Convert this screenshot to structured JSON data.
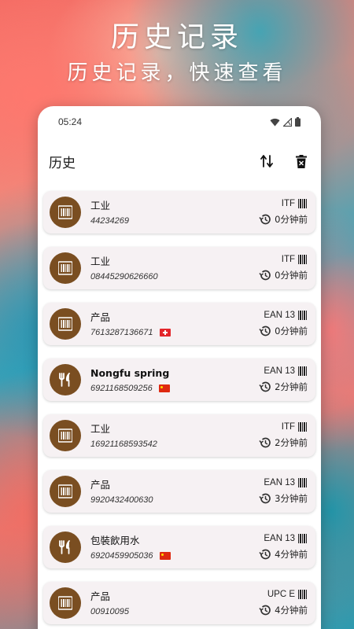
{
  "hero": {
    "title": "历史记录",
    "subtitle": "历史记录，快速查看"
  },
  "status_bar": {
    "time": "05:24",
    "icons": [
      "wifi-icon",
      "signal-icon",
      "battery-icon"
    ]
  },
  "app_bar": {
    "title": "历史",
    "actions": [
      "sort-icon",
      "delete-icon"
    ]
  },
  "colors": {
    "avatar_bg": "#7a4e21",
    "card_bg": "#f6f1f3",
    "text_primary": "#111111"
  },
  "history": [
    {
      "title": "工业",
      "code": "44234269",
      "type": "ITF",
      "time": "0分钟前",
      "icon": "barcode-icon",
      "flag": ""
    },
    {
      "title": "工业",
      "code": "08445290626660",
      "type": "ITF",
      "time": "0分钟前",
      "icon": "barcode-icon",
      "flag": ""
    },
    {
      "title": "产品",
      "code": "7613287136671",
      "type": "EAN 13",
      "time": "0分钟前",
      "icon": "barcode-icon",
      "flag": "switzerland-flag-icon"
    },
    {
      "title": "Nongfu spring",
      "code": "6921168509256",
      "type": "EAN 13",
      "time": "2分钟前",
      "icon": "fork-knife-icon",
      "flag": "china-flag-icon"
    },
    {
      "title": "工业",
      "code": "16921168593542",
      "type": "ITF",
      "time": "2分钟前",
      "icon": "barcode-icon",
      "flag": ""
    },
    {
      "title": "产品",
      "code": "9920432400630",
      "type": "EAN 13",
      "time": "3分钟前",
      "icon": "barcode-icon",
      "flag": ""
    },
    {
      "title": "包裝飲用水",
      "code": "6920459905036",
      "type": "EAN 13",
      "time": "4分钟前",
      "icon": "fork-knife-icon",
      "flag": "china-flag-icon"
    },
    {
      "title": "产品",
      "code": "00910095",
      "type": "UPC E",
      "time": "4分钟前",
      "icon": "barcode-icon",
      "flag": ""
    }
  ]
}
